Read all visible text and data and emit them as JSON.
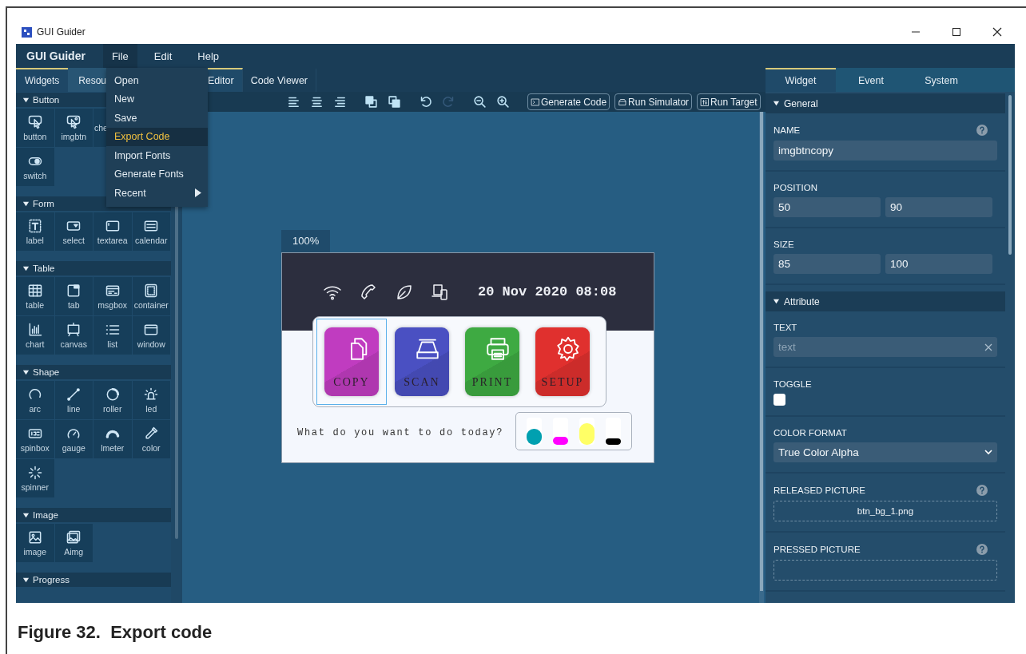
{
  "window": {
    "title": "GUI Guider"
  },
  "menubar": {
    "app_name": "GUI Guider",
    "menus": [
      {
        "label": "File",
        "selected": true
      },
      {
        "label": "Edit",
        "selected": false
      },
      {
        "label": "Help",
        "selected": false
      }
    ]
  },
  "file_menu": [
    {
      "label": "Open",
      "highlighted": false,
      "submenu": false
    },
    {
      "label": "New",
      "highlighted": false,
      "submenu": false
    },
    {
      "label": "Save",
      "highlighted": false,
      "submenu": false
    },
    {
      "label": "Export Code",
      "highlighted": true,
      "submenu": false
    },
    {
      "label": "Import Fonts",
      "highlighted": false,
      "submenu": false
    },
    {
      "label": "Generate Fonts",
      "highlighted": false,
      "submenu": false
    },
    {
      "label": "Recent",
      "highlighted": false,
      "submenu": true
    }
  ],
  "widget_panel": {
    "tabs": [
      {
        "label": "Widgets",
        "selected": true
      },
      {
        "label": "Resou",
        "selected": false
      }
    ],
    "sections": [
      {
        "title": "Button",
        "expanded": true,
        "rows": [
          [
            {
              "label": "button",
              "kind": "button"
            },
            {
              "label": "imgbtn",
              "kind": "imgbtn"
            },
            {
              "label": "che",
              "kind": "checkbox"
            }
          ],
          [
            {
              "label": "switch",
              "kind": "switch"
            }
          ]
        ]
      },
      {
        "title": "Form",
        "expanded": true,
        "rows": [
          [
            {
              "label": "label",
              "kind": "label"
            },
            {
              "label": "select",
              "kind": "select"
            },
            {
              "label": "textarea",
              "kind": "textarea"
            },
            {
              "label": "calendar",
              "kind": "calendar"
            }
          ]
        ]
      },
      {
        "title": "Table",
        "expanded": true,
        "rows": [
          [
            {
              "label": "table",
              "kind": "table"
            },
            {
              "label": "tab",
              "kind": "tab"
            },
            {
              "label": "msgbox",
              "kind": "msgbox"
            },
            {
              "label": "container",
              "kind": "container"
            }
          ],
          [
            {
              "label": "chart",
              "kind": "chart"
            },
            {
              "label": "canvas",
              "kind": "canvas"
            },
            {
              "label": "list",
              "kind": "list"
            },
            {
              "label": "window",
              "kind": "window"
            }
          ]
        ]
      },
      {
        "title": "Shape",
        "expanded": true,
        "rows": [
          [
            {
              "label": "arc",
              "kind": "arc"
            },
            {
              "label": "line",
              "kind": "line"
            },
            {
              "label": "roller",
              "kind": "roller"
            },
            {
              "label": "led",
              "kind": "led"
            }
          ],
          [
            {
              "label": "spinbox",
              "kind": "spinbox"
            },
            {
              "label": "gauge",
              "kind": "gauge"
            },
            {
              "label": "lmeter",
              "kind": "lmeter"
            },
            {
              "label": "color",
              "kind": "color"
            }
          ],
          [
            {
              "label": "spinner",
              "kind": "spinner"
            }
          ]
        ]
      },
      {
        "title": "Image",
        "expanded": true,
        "rows": [
          [
            {
              "label": "image",
              "kind": "image"
            },
            {
              "label": "Aimg",
              "kind": "animimg"
            }
          ]
        ]
      },
      {
        "title": "Progress",
        "expanded": true
      }
    ]
  },
  "editor": {
    "tabs": [
      {
        "label": "Editor",
        "selected": true
      },
      {
        "label": "Code Viewer",
        "selected": false
      }
    ],
    "tools": [
      {
        "kind": "align-left",
        "disabled": false
      },
      {
        "kind": "align-center",
        "disabled": false
      },
      {
        "kind": "align-right",
        "disabled": false
      },
      {
        "kind": "layer-up",
        "disabled": false
      },
      {
        "kind": "layer-down",
        "disabled": false
      },
      {
        "kind": "undo",
        "disabled": false
      },
      {
        "kind": "redo",
        "disabled": true
      },
      {
        "kind": "zoom-out",
        "disabled": false
      },
      {
        "kind": "zoom-in",
        "disabled": false
      }
    ],
    "actions": [
      {
        "label": "Generate Code",
        "kind": "terminal"
      },
      {
        "label": "Run Simulator",
        "kind": "simulator"
      },
      {
        "label": "Run Target",
        "kind": "target"
      }
    ],
    "zoom": "100%",
    "device": {
      "status_icons": [
        {
          "kind": "wifi"
        },
        {
          "kind": "phone"
        },
        {
          "kind": "leaf"
        },
        {
          "kind": "devices"
        }
      ],
      "datetime": "20 Nov 2020 08:08",
      "buttons": [
        {
          "label": "COPY",
          "kind": "copy",
          "color": "#c03cc0",
          "selected": true
        },
        {
          "label": "SCAN",
          "kind": "scan",
          "color": "#4a50c2",
          "selected": false
        },
        {
          "label": "PRINT",
          "kind": "print",
          "color": "#3eaa42",
          "selected": false
        },
        {
          "label": "SETUP",
          "kind": "setup",
          "color": "#e0302e",
          "selected": false
        }
      ],
      "prompt": "What do you want to do today?",
      "inks": [
        {
          "color": "#00a0b0",
          "level": 0.6
        },
        {
          "color": "#ff00ff",
          "level": 0.3
        },
        {
          "color": "#ffff66",
          "level": 0.8
        },
        {
          "color": "#000000",
          "level": 0.25
        }
      ]
    }
  },
  "properties": {
    "tabs": [
      {
        "label": "Widget",
        "selected": true
      },
      {
        "label": "Event",
        "selected": false
      },
      {
        "label": "System",
        "selected": false
      }
    ],
    "sections": [
      {
        "title": "General",
        "expanded": true,
        "fields": [
          {
            "kind": "text",
            "label": "NAME",
            "help": true,
            "value": "imgbtncopy"
          },
          {
            "kind": "pair",
            "label": "POSITION",
            "help": false,
            "values": [
              "50",
              "90"
            ]
          },
          {
            "kind": "pair",
            "label": "SIZE",
            "help": false,
            "values": [
              "85",
              "100"
            ]
          }
        ]
      },
      {
        "title": "Attribute",
        "expanded": true,
        "fields": [
          {
            "kind": "clearable",
            "label": "TEXT",
            "help": false,
            "placeholder": "text"
          },
          {
            "kind": "checkbox",
            "label": "TOGGLE",
            "help": false,
            "checked": false
          },
          {
            "kind": "select",
            "label": "COLOR FORMAT",
            "help": false,
            "value": "True Color Alpha"
          },
          {
            "kind": "file",
            "label": "RELEASED PICTURE",
            "help": true,
            "value": "btn_bg_1.png"
          },
          {
            "kind": "file",
            "label": "PRESSED PICTURE",
            "help": true
          }
        ]
      }
    ]
  },
  "figure_caption": "Figure 32.  Export code"
}
